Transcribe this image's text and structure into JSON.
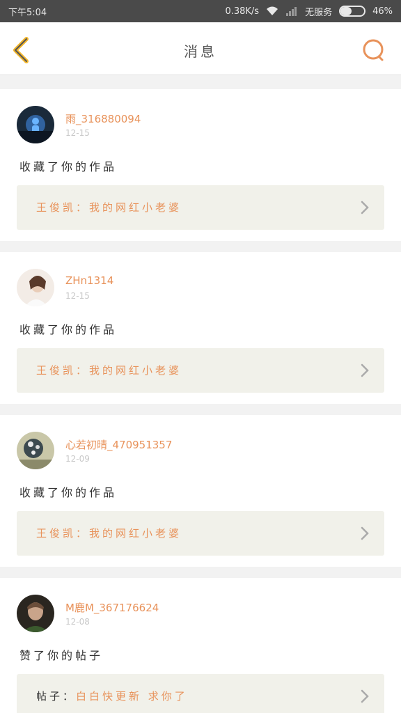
{
  "status_bar": {
    "time": "下午5:04",
    "speed": "0.38K/s",
    "carrier": "无服务",
    "battery_percent": "46%",
    "battery_level": 0.46
  },
  "header": {
    "title": "消息",
    "back_icon": "chevron-left-icon",
    "search_icon": "search-icon"
  },
  "colors": {
    "accent": "#e8925a",
    "back": "#f2b52a"
  },
  "messages": [
    {
      "username": "雨_316880094",
      "time": "12-15",
      "action": "收藏了你的作品",
      "ref_label": "王俊凯：",
      "ref_text": "我的网红小老婆"
    },
    {
      "username": "ZHn1314",
      "time": "12-15",
      "action": "收藏了你的作品",
      "ref_label": "王俊凯：",
      "ref_text": "我的网红小老婆"
    },
    {
      "username": "心若初晴_470951357",
      "time": "12-09",
      "action": "收藏了你的作品",
      "ref_label": "王俊凯：",
      "ref_text": "我的网红小老婆"
    },
    {
      "username": "M鹿M_367176624",
      "time": "12-08",
      "action": "赞了你的帖子",
      "ref_label": "帖子：",
      "ref_text": "白白快更新 求你了"
    }
  ]
}
